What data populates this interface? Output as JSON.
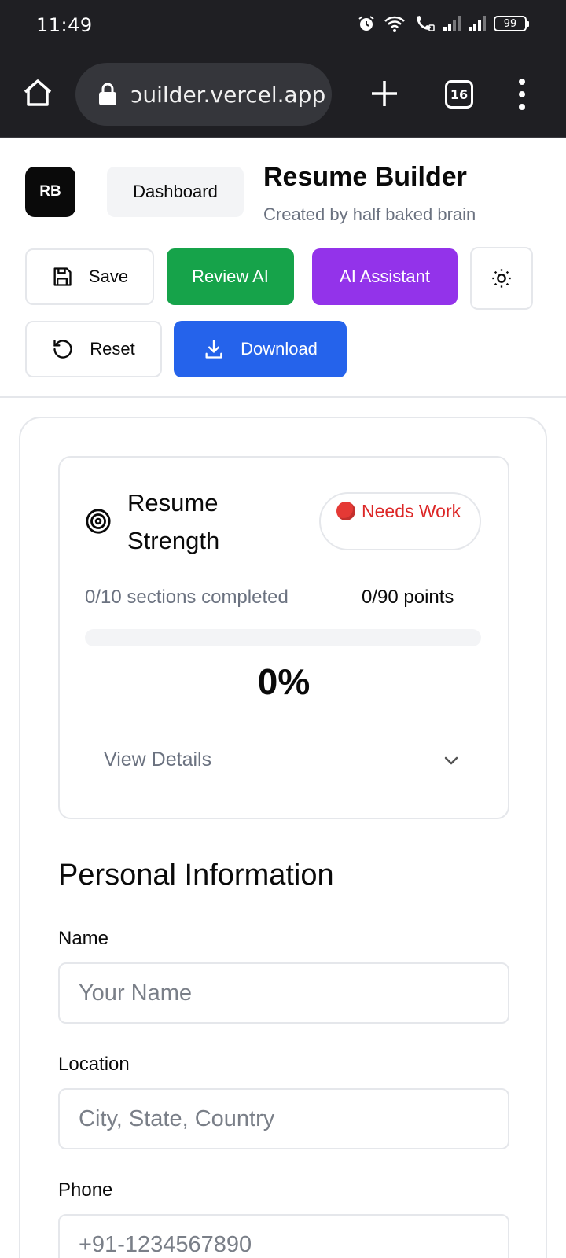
{
  "status_bar": {
    "time": "11:49",
    "battery": "99"
  },
  "browser": {
    "url": "ɔuilder.vercel.app",
    "tab_count": "16"
  },
  "header": {
    "logo": "RB",
    "dashboard_label": "Dashboard",
    "title": "Resume Builder",
    "subtitle": "Created by half baked brain"
  },
  "toolbar": {
    "save_label": "Save",
    "review_label": "Review AI",
    "assistant_label": "AI Assistant",
    "reset_label": "Reset",
    "download_label": "Download"
  },
  "colors": {
    "review": "#16a34a",
    "assistant": "#9333ea",
    "download": "#2563eb",
    "badge_text": "#dc2626"
  },
  "strength": {
    "title": "Resume Strength",
    "badge_label": "Needs Work",
    "sections_completed": "0/10 sections completed",
    "points": "0/90 points",
    "progress_fraction": 0,
    "percent": "0%",
    "view_details": "View Details"
  },
  "personal_info": {
    "title": "Personal Information",
    "fields": [
      {
        "label": "Name",
        "placeholder": "Your Name",
        "value": ""
      },
      {
        "label": "Location",
        "placeholder": "City, State, Country",
        "value": ""
      },
      {
        "label": "Phone",
        "placeholder": "+91-1234567890",
        "value": ""
      }
    ]
  }
}
